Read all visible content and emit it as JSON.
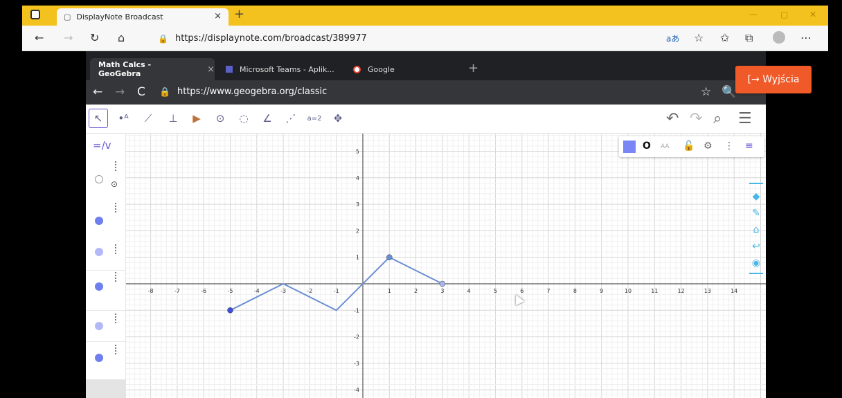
{
  "edge": {
    "tab_title": "DisplayNote Broadcast",
    "tab_close": "×",
    "new_tab": "+",
    "url": "https://displaynote.com/broadcast/389977",
    "window_controls": [
      "—",
      "▢",
      "✕"
    ]
  },
  "chrome": {
    "tabs": [
      {
        "label": "Math Calcs - GeoGebra",
        "active": true
      },
      {
        "label": "Microsoft Teams - Aplik...",
        "active": false
      },
      {
        "label": "Google",
        "active": false
      }
    ],
    "tab_close": "×",
    "new_tab": "+",
    "url": "https://www.geogebra.org/classic"
  },
  "geogebra": {
    "algebra_header": "=/v",
    "style_bar": {
      "color": "#7a86f5",
      "label": "AA"
    }
  },
  "overlay": {
    "exit_label": "[→ Wyjścia"
  },
  "chart_data": {
    "type": "line",
    "x_ticks": [
      -8,
      -7,
      -6,
      -5,
      -4,
      -3,
      -2,
      -1,
      1,
      2,
      3,
      4,
      5,
      6,
      7,
      8,
      9,
      10,
      11,
      12,
      13,
      14
    ],
    "y_ticks": [
      -4,
      -3,
      -2,
      -1,
      1,
      2,
      3,
      4,
      5
    ],
    "xlim": [
      -8.8,
      14.9
    ],
    "ylim": [
      -4.3,
      5.5
    ],
    "grid": true,
    "series": [
      {
        "points": [
          [
            -5,
            -1
          ],
          [
            -3,
            0
          ],
          [
            -1,
            -1
          ],
          [
            1,
            1
          ],
          [
            3,
            0
          ]
        ],
        "color": "#6b8fd4"
      }
    ],
    "marked_points": [
      {
        "x": -5,
        "y": -1,
        "color": "#3f4fd6"
      },
      {
        "x": 1,
        "y": 1,
        "color": "#6b8fd4"
      },
      {
        "x": 3,
        "y": 0,
        "color": "#a9b6f0"
      }
    ]
  }
}
